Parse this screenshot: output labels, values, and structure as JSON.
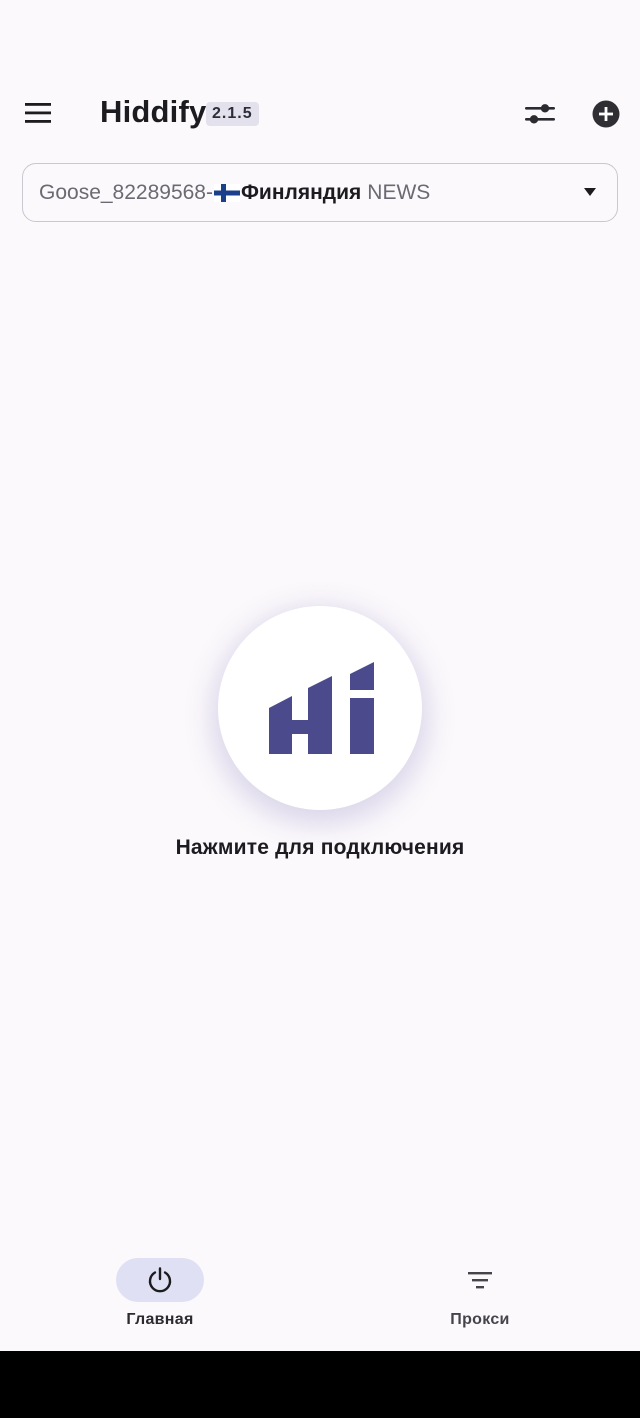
{
  "app": {
    "title": "Hiddify",
    "version": "2.1.5"
  },
  "toolbar": {
    "menu_icon": "menu-icon",
    "filter_icon": "tune-icon",
    "add_icon": "add-circle-icon"
  },
  "profile": {
    "name": "Goose_82289568-",
    "flag": "finland-flag-icon",
    "country": "Финляндия",
    "tag": "NEWS"
  },
  "connect": {
    "hint": "Нажмите для подключения",
    "logo": "hiddify-logo-icon"
  },
  "nav": {
    "home_label": "Главная",
    "proxy_label": "Прокси"
  },
  "colors": {
    "brand": "#4a4a8c",
    "background": "#fcf9fc",
    "active_pill": "#dfe0f3"
  }
}
